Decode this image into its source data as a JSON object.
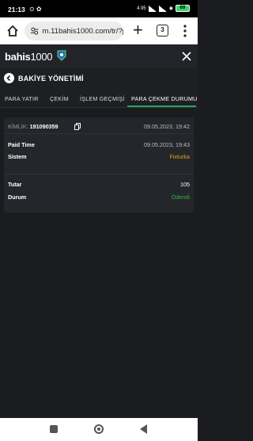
{
  "statusbar": {
    "time": "21:13",
    "status_icons": "⊙ ✿",
    "network": "4.95",
    "battery": "69"
  },
  "browser": {
    "url": "m.11bahis1000.com/tr/?p",
    "tab_count": "3"
  },
  "site": {
    "logo_text": "bahis",
    "logo_number": "1000"
  },
  "page": {
    "title": "BAKİYE YÖNETİMİ"
  },
  "tabs": [
    {
      "label": "PARA YATIR"
    },
    {
      "label": "ÇEKİM"
    },
    {
      "label": "İŞLEM GEÇMİŞİ"
    },
    {
      "label": "PARA ÇEKME DURUMU"
    }
  ],
  "card": {
    "id_label": "KİMLİK:",
    "id_value": "191090359",
    "created": "09.05.2023, 19:42",
    "paid_time_label": "Paid Time",
    "paid_time_value": "09.05.2023, 19:43",
    "system_label": "Sistem",
    "system_value": "Fixturka",
    "amount_label": "Tutar",
    "amount_value": "105",
    "status_label": "Durum",
    "status_value": "Ödendi"
  },
  "colors": {
    "accent": "#27a35d",
    "orange": "#e9a01b",
    "paid": "#2fb14e"
  }
}
